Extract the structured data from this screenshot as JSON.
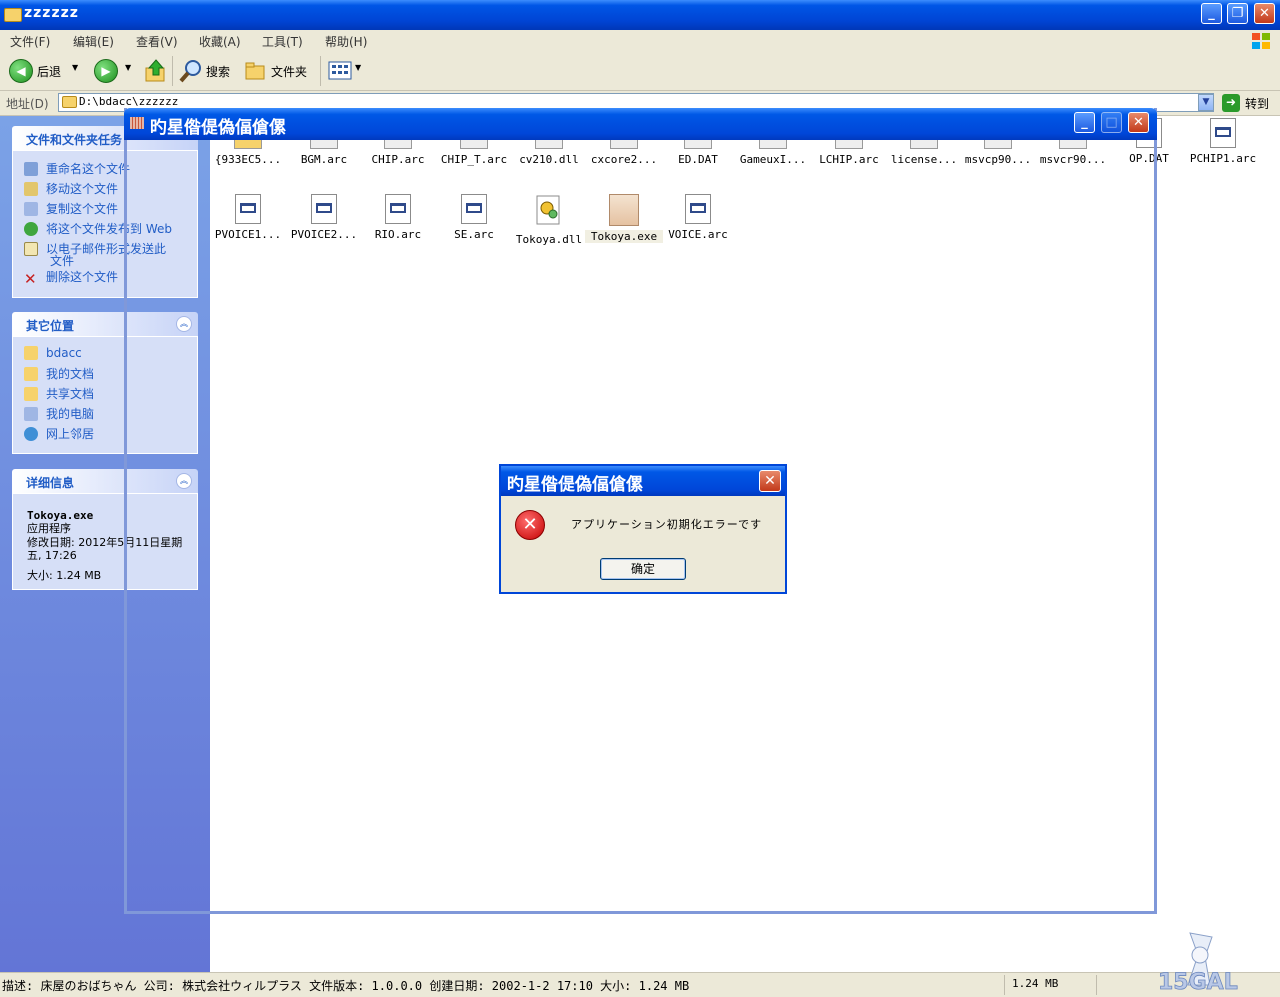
{
  "window": {
    "title": "zzzzzz"
  },
  "menu": [
    "文件(F)",
    "编辑(E)",
    "查看(V)",
    "收藏(A)",
    "工具(T)",
    "帮助(H)"
  ],
  "toolbar": {
    "back": "后退",
    "search": "搜索",
    "folders": "文件夹"
  },
  "address": {
    "label": "地址(D)",
    "value": "D:\\bdacc\\zzzzzz",
    "go": "转到"
  },
  "tasks": {
    "title": "文件和文件夹任务",
    "items": [
      "重命名这个文件",
      "移动这个文件",
      "复制这个文件",
      "将这个文件发布到 Web",
      "以电子邮件形式发送此",
      "文件",
      "删除这个文件"
    ]
  },
  "places": {
    "title": "其它位置",
    "items": [
      "bdacc",
      "我的文档",
      "共享文档",
      "我的电脑",
      "网上邻居"
    ]
  },
  "details": {
    "title": "详细信息",
    "name": "Tokoya.exe",
    "type": "应用程序",
    "modified": "修改日期: 2012年5月11日星期五, 17:26",
    "size": "大小: 1.24 MB"
  },
  "files_row1": [
    "{933EC5...",
    "BGM.arc",
    "CHIP.arc",
    "CHIP_T.arc",
    "cv210.dll",
    "cxcore2...",
    "ED.DAT",
    "GameuxI...",
    "LCHIP.arc",
    "license...",
    "msvcp90...",
    "msvcr90...",
    "OP.DAT",
    "PCHIP1.arc"
  ],
  "files_row2": [
    "PVOICE1...",
    "PVOICE2...",
    "RIO.arc",
    "SE.arc",
    "Tokoya.dll",
    "Tokoya.exe",
    "VOICE.arc"
  ],
  "ghost_window": {
    "title": "旳星偺偍偽偪傖傫"
  },
  "dialog": {
    "title": "旳星偺偍偽偪傖傫",
    "message": "アプリケーション初期化エラーです",
    "ok": "确定"
  },
  "status": {
    "text": "描述: 床屋のおばちゃん 公司: 株式会社ウィルプラス 文件版本: 1.0.0.0 创建日期: 2002-1-2 17:10 大小: 1.24 MB",
    "size": "1.24 MB"
  }
}
